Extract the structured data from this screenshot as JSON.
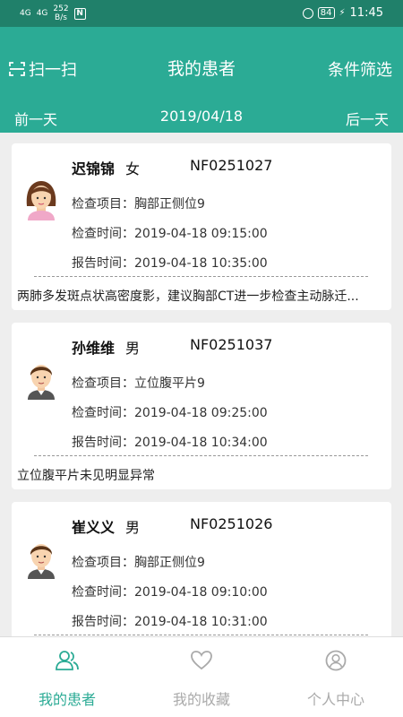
{
  "status_bar": {
    "signal1": "4G",
    "signal2": "4G",
    "speed_value": "252",
    "speed_unit": "B/s",
    "nfc": "N",
    "battery": "84",
    "time": "11:45"
  },
  "header": {
    "scan_label": "扫一扫",
    "title": "我的患者",
    "filter_label": "条件筛选",
    "prev_day": "前一天",
    "date": "2019/04/18",
    "next_day": "后一天"
  },
  "labels": {
    "exam_item": "检查项目：",
    "exam_time": "检查时间：",
    "report_time": "报告时间："
  },
  "patients": [
    {
      "name": "迟锦锦",
      "gender": "女",
      "id": "NF0251027",
      "exam_item": "胸部正侧位9",
      "exam_time": "2019-04-18 09:15:00",
      "report_time": "2019-04-18 10:35:00",
      "summary": "两肺多发斑点状高密度影，建议胸部CT进一步检查主动脉迁...",
      "avatar": "female-avatar"
    },
    {
      "name": "孙维维",
      "gender": "男",
      "id": "NF0251037",
      "exam_item": "立位腹平片9",
      "exam_time": "2019-04-18 09:25:00",
      "report_time": "2019-04-18 10:34:00",
      "summary": "立位腹平片未见明显异常",
      "avatar": "male-avatar"
    },
    {
      "name": "崔义义",
      "gender": "男",
      "id": "NF0251026",
      "exam_item": "胸部正侧位9",
      "exam_time": "2019-04-18 09:10:00",
      "report_time": "2019-04-18 10:31:00",
      "summary": "",
      "avatar": "male-avatar"
    }
  ],
  "tabs": [
    {
      "label": "我的患者",
      "icon": "patients-icon",
      "active": true
    },
    {
      "label": "我的收藏",
      "icon": "heart-icon",
      "active": false
    },
    {
      "label": "个人中心",
      "icon": "user-icon",
      "active": false
    }
  ],
  "colors": {
    "status_bar": "#20806a",
    "header": "#2bab95",
    "active_tab": "#2bab95",
    "inactive_tab": "#aaaaaa"
  }
}
